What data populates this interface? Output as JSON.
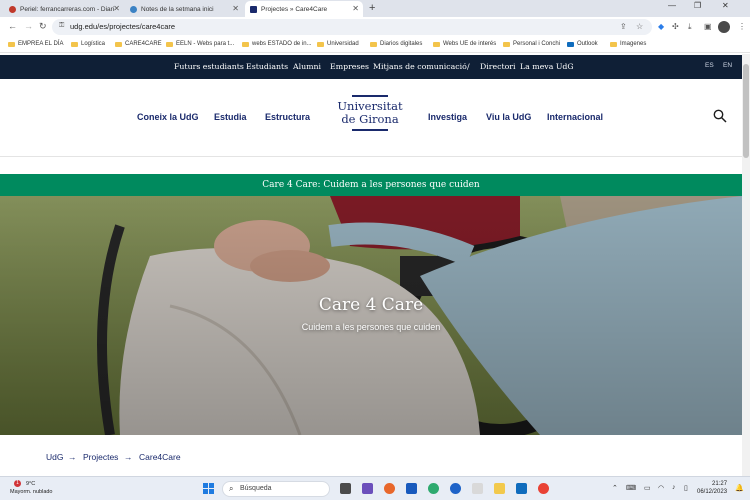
{
  "browser": {
    "tabs": [
      {
        "label": "Periel: ferrancarreras.com - Diari",
        "active": false
      },
      {
        "label": "Notes de la setmana inici",
        "active": false
      },
      {
        "label": "Projectes » Care4Care",
        "active": true
      }
    ],
    "new_tab": "+",
    "url": "udg.edu/es/projectes/care4care",
    "bookmarks": [
      "EMPREA EL DÍA",
      "Logística",
      "CARE4CARE",
      "EELN - Webs para t...",
      "webs ESTADO de in...",
      "Universidad",
      "Diarios digitales",
      "Webs UE de interés",
      "Personal i Conchi",
      "Outlook",
      "Imagenes"
    ]
  },
  "site": {
    "topnav": [
      "Futurs estudiants",
      "Estudiants",
      "Alumni",
      "Empreses",
      "Mitjans de comunicació",
      "/",
      "Directori",
      "La meva UdG"
    ],
    "languages": [
      "ES",
      "EN"
    ],
    "mainnav_left": [
      "Coneix la UdG",
      "Estudia",
      "Estructura"
    ],
    "mainnav_right": [
      "Investiga",
      "Viu la UdG",
      "Internacional"
    ],
    "logo": {
      "line1": "Universitat",
      "line2": "de Girona"
    },
    "announcement": "Care 4 Care: Cuidem a les persones que cuiden",
    "hero": {
      "title": "Care 4 Care",
      "subtitle": "Cuidem a les persones que cuiden"
    },
    "breadcrumb": [
      "UdG",
      "Projectes",
      "Care4Care"
    ]
  },
  "taskbar": {
    "weather_badge": "1",
    "temperature": "9°C",
    "weather_desc": "Mayorm. nublado",
    "search_placeholder": "Búsqueda",
    "time": "21:27",
    "date": "06/12/2023"
  },
  "colors": {
    "navy": "#0f1f36",
    "brand_blue": "#1a2a6c",
    "green": "#008a5e"
  }
}
